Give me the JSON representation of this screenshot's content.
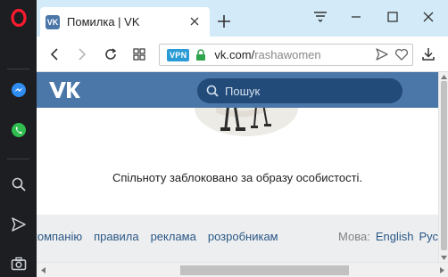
{
  "browser": {
    "tab": {
      "title": "Помилка | VK",
      "favicon_text": "VK"
    },
    "address": {
      "vpn_badge": "VPN",
      "host": "vk.com/",
      "path": "rashawomen"
    }
  },
  "vk": {
    "search_placeholder": "Пошук",
    "message": "Спільноту заблоковано за образу особистості.",
    "footer": {
      "links": [
        "компанію",
        "правила",
        "реклама",
        "розробникам"
      ],
      "language_label": "Мова:",
      "languages": [
        "English",
        "Русский"
      ]
    }
  },
  "colors": {
    "vk_header": "#4a76a8",
    "vk_link": "#2a5885",
    "sidebar": "#1c1e22",
    "tabstrip": "#d3ebf8",
    "opera_red": "#ff1b2d"
  }
}
